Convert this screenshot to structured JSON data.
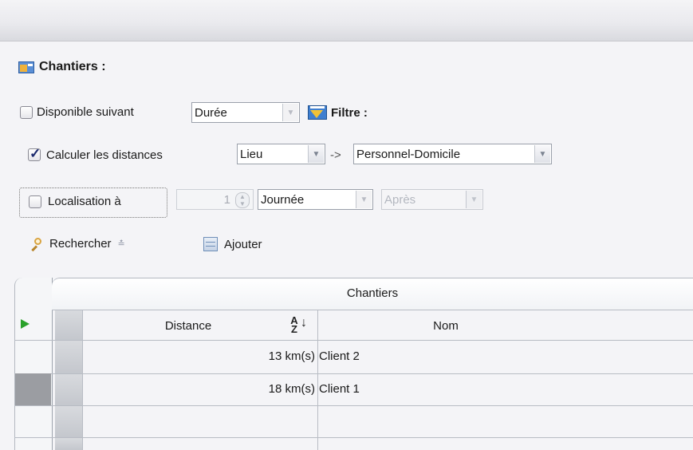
{
  "section": {
    "title": "Chantiers :"
  },
  "row1": {
    "checkbox_label": "Disponible suivant",
    "checked": false,
    "combo_value": "Durée",
    "filter_label": "Filtre :"
  },
  "row2": {
    "checkbox_label": "Calculer les distances",
    "checked": true,
    "from_value": "Lieu",
    "arrow_text": "->",
    "to_value": "Personnel-Domicile"
  },
  "row3": {
    "checkbox_label": "Localisation à",
    "checked": false,
    "spin_value": "1",
    "period_value": "Journée",
    "when_value": "Après"
  },
  "toolbar": {
    "search_label": "Rechercher",
    "add_label": "Ajouter"
  },
  "grid": {
    "group_header": "Chantiers",
    "columns": [
      "Distance",
      "Nom"
    ],
    "sort_glyph": "A Z ↓",
    "rows": [
      {
        "distance": "13 km(s)",
        "nom": "Client 2"
      },
      {
        "distance": "18 km(s)",
        "nom": "Client 1"
      }
    ]
  }
}
